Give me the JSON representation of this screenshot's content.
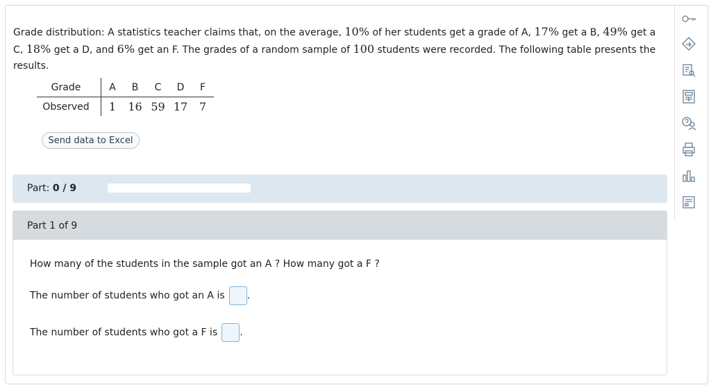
{
  "problem": {
    "lead": "Grade distribution",
    "t1": ": A statistics teacher claims that, on the average, ",
    "pA": "10%",
    "t2": " of her students get a grade of A, ",
    "pB": "17%",
    "t3": " get a B, ",
    "pC": "49%",
    "t4": " get a C, ",
    "pD": "18%",
    "t5": " get a D, and ",
    "pF": "6%",
    "t6": " get an F. The grades of a random sample of ",
    "n": "100",
    "t7": " students were recorded. The following table presents the results."
  },
  "table": {
    "row1_label": "Grade",
    "row2_label": "Observed",
    "grades": [
      "A",
      "B",
      "C",
      "D",
      "F"
    ],
    "observed": [
      "1",
      "16",
      "59",
      "17",
      "7"
    ]
  },
  "excel_button": "Send data to Excel",
  "progress": {
    "label": "Part:",
    "value": "0 / 9",
    "fraction": 0
  },
  "part": {
    "header": "Part 1 of 9",
    "question": "How many of the students in the sample got an A ? How many got a F ?",
    "q1": "The number of students who got an A is",
    "q2": "The number of students who got a F is",
    "period": "."
  },
  "toolbar": {
    "icons": [
      "key-icon",
      "navigate-icon",
      "search-doc-icon",
      "calculator-icon",
      "help-icon",
      "print-icon",
      "chart-icon",
      "data-icon"
    ]
  }
}
